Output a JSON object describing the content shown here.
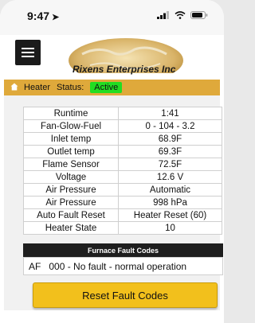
{
  "status_bar": {
    "time": "9:47",
    "location_arrow": "➤"
  },
  "app": {
    "logo_text": "Rixens Enterprises Inc",
    "menu_icon": "hamburger-icon"
  },
  "heater": {
    "label": "Heater",
    "status_label": "Status:",
    "status_value": "Active",
    "status_color": "#22dd22",
    "bar_color": "#dfa93b"
  },
  "readings": [
    {
      "key": "Runtime",
      "value": "1:41"
    },
    {
      "key": "Fan-Glow-Fuel",
      "value": "0 - 104 - 3.2"
    },
    {
      "key": "Inlet temp",
      "value": "68.9F"
    },
    {
      "key": "Outlet temp",
      "value": "69.3F"
    },
    {
      "key": "Flame Sensor",
      "value": "72.5F"
    },
    {
      "key": "Voltage",
      "value": "12.6 V"
    },
    {
      "key": "Air Pressure",
      "value": "Automatic"
    },
    {
      "key": "Air Pressure",
      "value": "998 hPa"
    },
    {
      "key": "Auto Fault Reset",
      "value": "Heater Reset (60)"
    },
    {
      "key": "Heater State",
      "value": "10"
    }
  ],
  "faults": {
    "header": "Furnace Fault Codes",
    "code": "AF",
    "description": "000 - No fault - normal operation"
  },
  "actions": {
    "reset_label": "Reset Fault Codes",
    "button_color": "#f2c01c"
  }
}
